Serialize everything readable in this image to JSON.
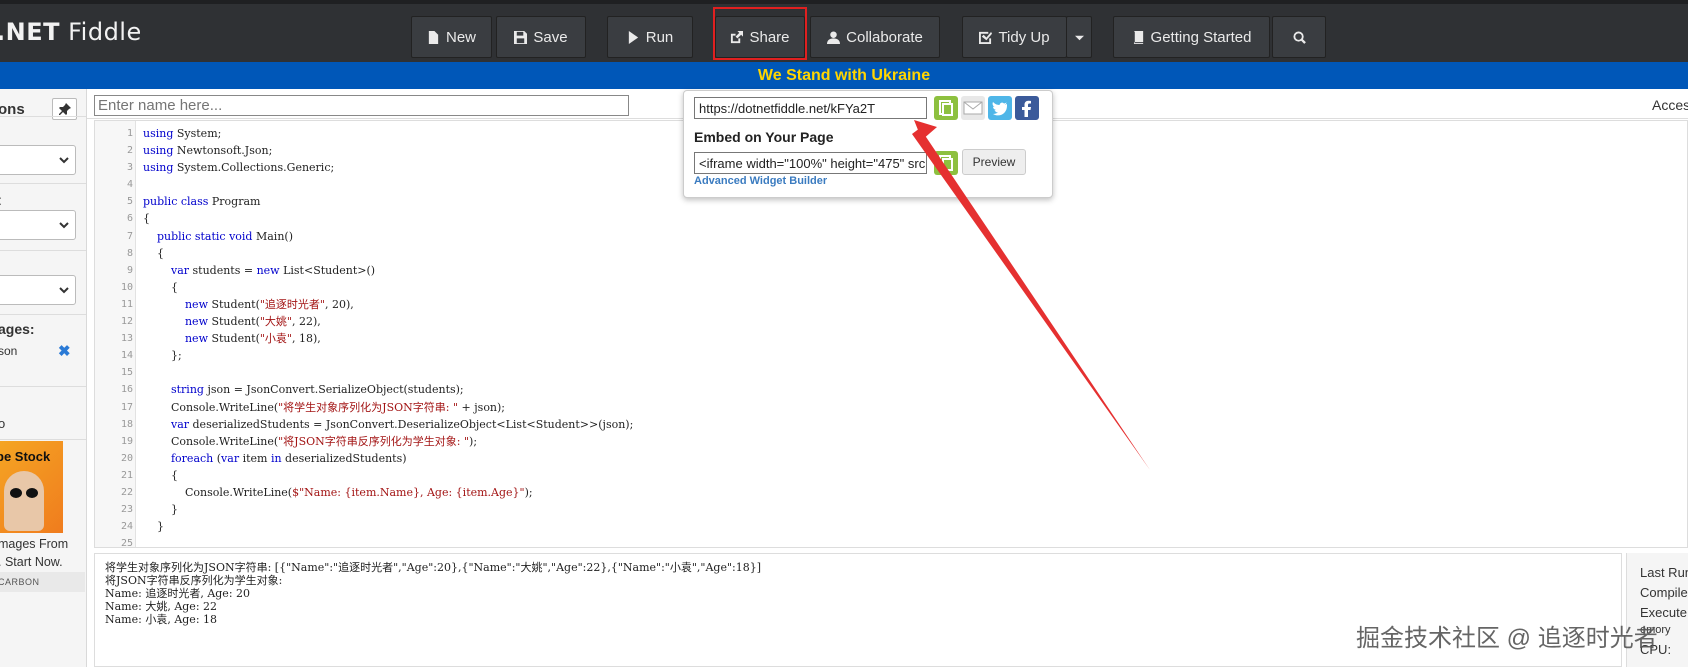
{
  "brand": {
    "prefix": ".NET",
    "suffix": "Fiddle"
  },
  "toolbar": {
    "new_label": "New",
    "save_label": "Save",
    "run_label": "Run",
    "share_label": "Share",
    "collaborate_label": "Collaborate",
    "tidy_label": "Tidy Up",
    "getting_started_label": "Getting Started"
  },
  "banner": {
    "text": "We Stand with Ukraine"
  },
  "sidebar": {
    "title": "ons",
    "label_2": ":",
    "packages_label": "ages:",
    "package_name": "son",
    "stray_label": "o",
    "ad_caption": "be Stock",
    "ad_line_1": "mages From",
    "ad_line_2": ". Start Now.",
    "ad_carbon": "CARBON"
  },
  "namebar": {
    "placeholder": "Enter name here...",
    "right_label": "Acces"
  },
  "share_popover": {
    "url": "https://dotnetfiddle.net/kFYa2T",
    "embed_heading": "Embed on Your Page",
    "embed_code": "<iframe width=\"100%\" height=\"475\" src",
    "preview_label": "Preview",
    "widget_link": "Advanced Widget Builder"
  },
  "editor": {
    "lines": [
      {
        "n": "1",
        "html": "<span class='kw'>using</span> System;"
      },
      {
        "n": "2",
        "html": "<span class='kw'>using</span> Newtonsoft.Json;"
      },
      {
        "n": "3",
        "html": "<span class='kw'>using</span> System.Collections.Generic;"
      },
      {
        "n": "4",
        "html": ""
      },
      {
        "n": "5",
        "html": "<span class='kw'>public class</span> Program"
      },
      {
        "n": "6",
        "html": "{"
      },
      {
        "n": "7",
        "html": "    <span class='kw'>public static void</span> Main()"
      },
      {
        "n": "8",
        "html": "    {"
      },
      {
        "n": "9",
        "html": "        <span class='kw'>var</span> students = <span class='kw'>new</span> List&lt;Student&gt;()"
      },
      {
        "n": "10",
        "html": "        {"
      },
      {
        "n": "11",
        "html": "            <span class='kw'>new</span> Student(<span class='str'>\"追逐时光者\"</span>, 20),"
      },
      {
        "n": "12",
        "html": "            <span class='kw'>new</span> Student(<span class='str'>\"大姚\"</span>, 22),"
      },
      {
        "n": "13",
        "html": "            <span class='kw'>new</span> Student(<span class='str'>\"小袁\"</span>, 18),"
      },
      {
        "n": "14",
        "html": "        };"
      },
      {
        "n": "15",
        "html": ""
      },
      {
        "n": "16",
        "html": "        <span class='kw'>string</span> json = JsonConvert.SerializeObject(students);"
      },
      {
        "n": "17",
        "html": "        Console.WriteLine(<span class='str'>\"将学生对象序列化为JSON字符串: \"</span> + json);"
      },
      {
        "n": "18",
        "html": "        <span class='kw'>var</span> deserializedStudents = JsonConvert.DeserializeObject&lt;List&lt;Student&gt;&gt;(json);"
      },
      {
        "n": "19",
        "html": "        Console.WriteLine(<span class='str'>\"将JSON字符串反序列化为学生对象: \"</span>);"
      },
      {
        "n": "20",
        "html": "        <span class='kw'>foreach</span> (<span class='kw'>var</span> item <span class='kw'>in</span> deserializedStudents)"
      },
      {
        "n": "21",
        "html": "        {"
      },
      {
        "n": "22",
        "html": "            Console.WriteLine(<span class='str'>$\"Name: {item.Name}, Age: {item.Age}\"</span>);"
      },
      {
        "n": "23",
        "html": "        }"
      },
      {
        "n": "24",
        "html": "    }"
      },
      {
        "n": "25",
        "html": ""
      }
    ]
  },
  "output": {
    "lines": [
      "将学生对象序列化为JSON字符串: [{\"Name\":\"追逐时光者\",\"Age\":20},{\"Name\":\"大姚\",\"Age\":22},{\"Name\":\"小袁\",\"Age\":18}]",
      "将JSON字符串反序列化为学生对象:",
      "Name: 追逐时光者, Age: 20",
      "Name: 大姚, Age: 22",
      "Name: 小袁, Age: 18"
    ]
  },
  "stats": {
    "last_run": "Last Run",
    "compile": "Compile",
    "execute": "Execute",
    "memory": "emory",
    "cpu": "CPU:"
  },
  "watermark": {
    "text": "掘金技术社区 @ 追逐时光者"
  },
  "colors": {
    "navbar": "#2f3134",
    "banner_bg": "#0057b8",
    "banner_text": "#ffd500",
    "highlight": "#e02020",
    "keyword": "#0000cc",
    "string": "#a31515"
  }
}
